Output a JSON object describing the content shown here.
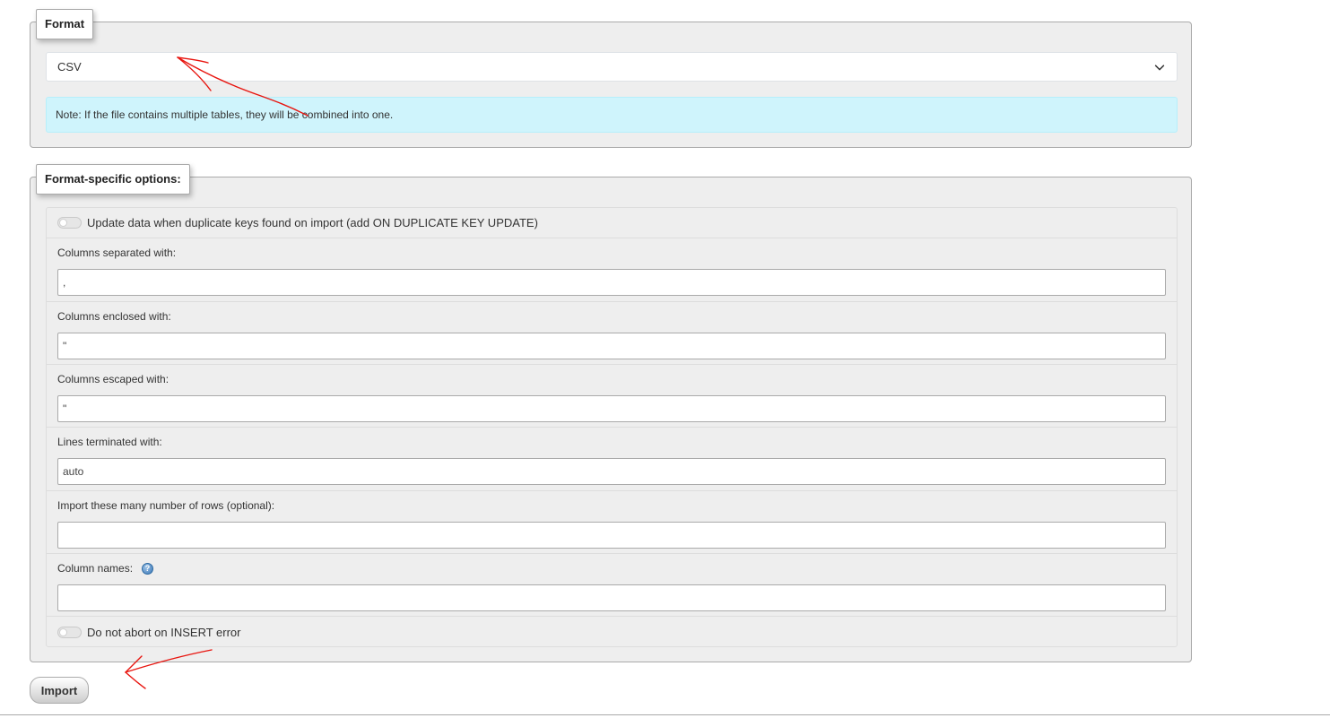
{
  "format_section": {
    "legend": "Format",
    "selected_format": "CSV",
    "note": "Note: If the file contains multiple tables, they will be combined into one."
  },
  "options_section": {
    "legend": "Format-specific options:",
    "update_duplicates_label": "Update data when duplicate keys found on import (add ON DUPLICATE KEY UPDATE)",
    "update_duplicates_checked": false,
    "fields": [
      {
        "label": "Columns separated with:",
        "value": ","
      },
      {
        "label": "Columns enclosed with:",
        "value": "\""
      },
      {
        "label": "Columns escaped with:",
        "value": "\""
      },
      {
        "label": "Lines terminated with:",
        "value": "auto"
      },
      {
        "label": "Import these many number of rows (optional):",
        "value": ""
      },
      {
        "label": "Column names:",
        "value": ""
      }
    ],
    "no_abort_label": "Do not abort on INSERT error",
    "no_abort_checked": false
  },
  "actions": {
    "import_label": "Import"
  },
  "colors": {
    "annotation": "#e8150f",
    "note_bg": "#cff4fc",
    "panel_bg": "#eeeeee"
  },
  "icons": {
    "help": "help-icon",
    "dropdown": "chevron-down-icon"
  }
}
